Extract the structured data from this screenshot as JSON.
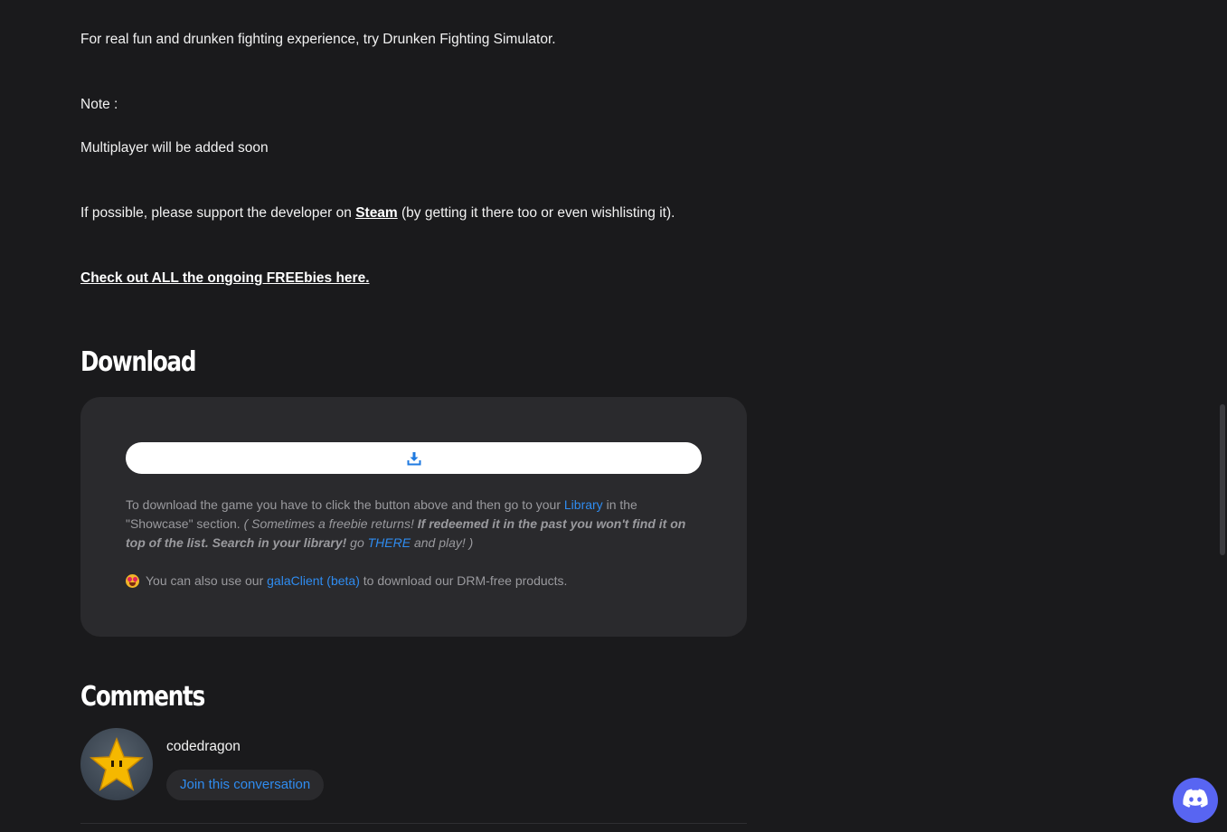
{
  "description": {
    "line1": "For real fun and drunken fighting experience, try Drunken Fighting Simulator.",
    "note_label": "Note :",
    "note_text": "Multiplayer will be added soon",
    "support_prefix": "If possible, please support the developer on ",
    "support_link": "Steam",
    "support_suffix": " (by getting it there too or even wishlisting it).",
    "freebies_link": "Check out ALL the ongoing FREEbies here."
  },
  "download": {
    "heading": "Download",
    "button_icon": "download-icon",
    "text_1": "To download the game you have to click the button above and then go to your ",
    "library_link": "Library",
    "text_2": " in the \"Showcase\" section. ",
    "italic_1": "( Sometimes a freebie returns! ",
    "bold_italic": "If redeemed it in the past you won't find it on top of the list. Search in your library!",
    "italic_2": " go ",
    "there_link": "THERE",
    "italic_3": " and play! )",
    "client_prefix": "You can also use our ",
    "client_link": "galaClient (beta)",
    "client_suffix": " to download our DRM-free products.",
    "client_emoji": "star-struck-emoji"
  },
  "comments": {
    "heading": "Comments",
    "username": "codedragon",
    "join_label": "Join this conversation",
    "avatar_icon": "star-avatar"
  },
  "floating": {
    "discord_icon": "discord-icon"
  },
  "colors": {
    "background": "#1a1a1c",
    "panel": "#2a2a2d",
    "link_blue": "#2f8cf0",
    "muted_text": "#9a9a9e",
    "discord": "#5865f2"
  }
}
